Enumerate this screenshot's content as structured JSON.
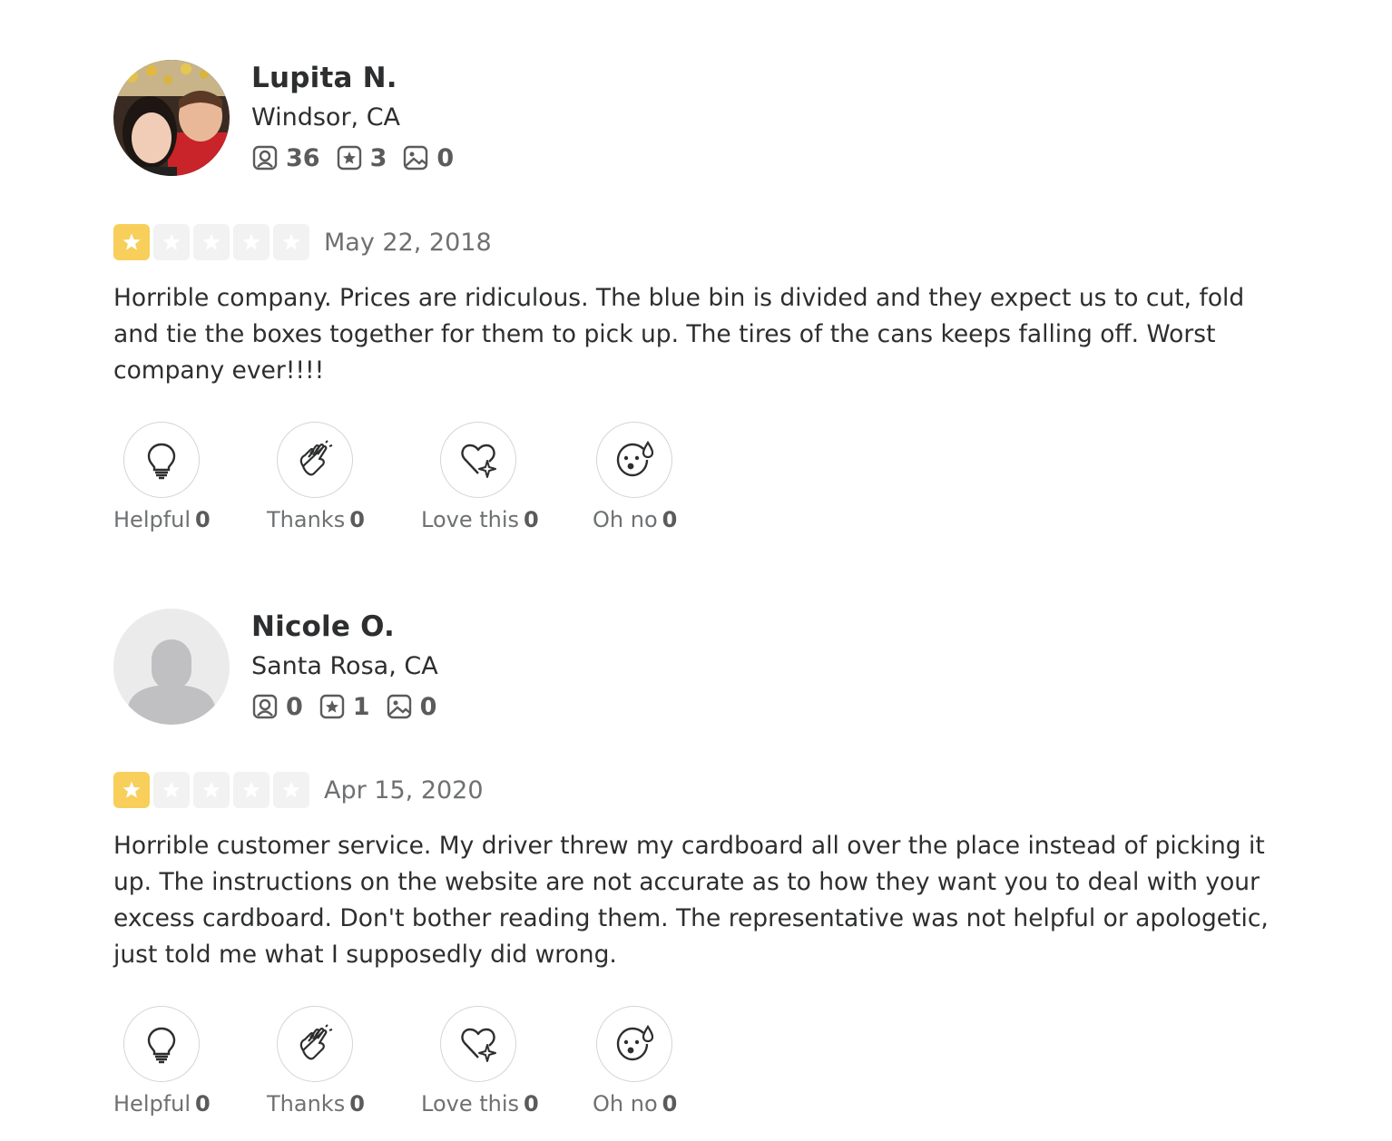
{
  "reviews": [
    {
      "user": {
        "name": "Lupita N.",
        "location": "Windsor, CA",
        "avatar": "photo-avatar",
        "stats": {
          "friends": "36",
          "reviews": "3",
          "photos": "0"
        }
      },
      "rating": 1,
      "max_rating": 5,
      "date": "May 22, 2018",
      "text": "Horrible company. Prices are ridiculous. The blue bin is divided and they expect us to cut, fold and tie the boxes together for them to pick up. The tires of the cans keeps falling off. Worst company ever!!!!",
      "reactions": [
        {
          "label": "Helpful",
          "count": "0",
          "icon": "lightbulb-icon"
        },
        {
          "label": "Thanks",
          "count": "0",
          "icon": "clapping-hands-icon"
        },
        {
          "label": "Love this",
          "count": "0",
          "icon": "heart-sparkle-icon"
        },
        {
          "label": "Oh no",
          "count": "0",
          "icon": "shocked-face-icon"
        }
      ]
    },
    {
      "user": {
        "name": "Nicole O.",
        "location": "Santa Rosa, CA",
        "avatar": "default-user-avatar",
        "stats": {
          "friends": "0",
          "reviews": "1",
          "photos": "0"
        }
      },
      "rating": 1,
      "max_rating": 5,
      "date": "Apr 15, 2020",
      "text": "Horrible customer service. My driver threw my cardboard all over the place instead of picking it up. The instructions on the website are not accurate as to how they want you to deal with your excess cardboard. Don't bother reading them. The representative was not helpful or apologetic, just told me what I supposedly did wrong.",
      "reactions": [
        {
          "label": "Helpful",
          "count": "0",
          "icon": "lightbulb-icon"
        },
        {
          "label": "Thanks",
          "count": "0",
          "icon": "clapping-hands-icon"
        },
        {
          "label": "Love this",
          "count": "0",
          "icon": "heart-sparkle-icon"
        },
        {
          "label": "Oh no",
          "count": "0",
          "icon": "shocked-face-icon"
        }
      ]
    }
  ],
  "colors": {
    "star_filled": "#f8cf5b",
    "star_empty": "#f2f2f2",
    "text": "#2d2e2f",
    "muted": "#6e7072"
  }
}
